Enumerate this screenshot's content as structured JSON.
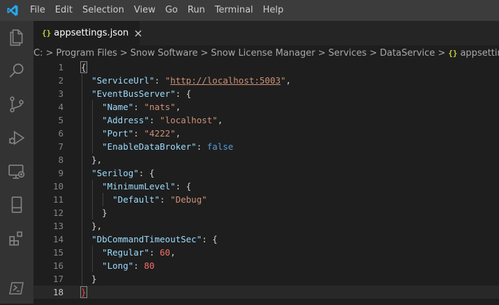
{
  "menu": [
    "File",
    "Edit",
    "Selection",
    "View",
    "Go",
    "Run",
    "Terminal",
    "Help"
  ],
  "tab": {
    "icon": "{}",
    "label": "appsettings.json"
  },
  "breadcrumb": {
    "parts": [
      "C:",
      "Program Files",
      "Snow Software",
      "Snow License Manager",
      "Services",
      "DataService"
    ],
    "file_icon": "{}",
    "file": "appsettings.json",
    "trailing": ">"
  },
  "lines": [
    {
      "n": "1",
      "tokens": [
        {
          "t": "{",
          "c": "brace-hl"
        }
      ]
    },
    {
      "n": "2",
      "tokens": [
        {
          "t": "  "
        },
        {
          "t": "\"ServiceUrl\"",
          "c": "k"
        },
        {
          "t": ": "
        },
        {
          "t": "\"",
          "c": "s"
        },
        {
          "t": "http://localhost:5003",
          "c": "s url"
        },
        {
          "t": "\"",
          "c": "s"
        },
        {
          "t": ","
        }
      ]
    },
    {
      "n": "3",
      "tokens": [
        {
          "t": "  "
        },
        {
          "t": "\"EventBusServer\"",
          "c": "k"
        },
        {
          "t": ": {"
        }
      ]
    },
    {
      "n": "4",
      "tokens": [
        {
          "t": "    "
        },
        {
          "t": "\"Name\"",
          "c": "k"
        },
        {
          "t": ": "
        },
        {
          "t": "\"nats\"",
          "c": "s"
        },
        {
          "t": ","
        }
      ]
    },
    {
      "n": "5",
      "tokens": [
        {
          "t": "    "
        },
        {
          "t": "\"Address\"",
          "c": "k"
        },
        {
          "t": ": "
        },
        {
          "t": "\"localhost\"",
          "c": "s"
        },
        {
          "t": ","
        }
      ]
    },
    {
      "n": "6",
      "tokens": [
        {
          "t": "    "
        },
        {
          "t": "\"Port\"",
          "c": "k"
        },
        {
          "t": ": "
        },
        {
          "t": "\"4222\"",
          "c": "s"
        },
        {
          "t": ","
        }
      ]
    },
    {
      "n": "7",
      "tokens": [
        {
          "t": "    "
        },
        {
          "t": "\"EnableDataBroker\"",
          "c": "k"
        },
        {
          "t": ": "
        },
        {
          "t": "false",
          "c": "kw"
        }
      ]
    },
    {
      "n": "8",
      "tokens": [
        {
          "t": "  },"
        }
      ]
    },
    {
      "n": "9",
      "tokens": [
        {
          "t": "  "
        },
        {
          "t": "\"Serilog\"",
          "c": "k"
        },
        {
          "t": ": {"
        }
      ]
    },
    {
      "n": "10",
      "tokens": [
        {
          "t": "    "
        },
        {
          "t": "\"MinimumLevel\"",
          "c": "k"
        },
        {
          "t": ": {"
        }
      ]
    },
    {
      "n": "11",
      "tokens": [
        {
          "t": "      "
        },
        {
          "t": "\"Default\"",
          "c": "k"
        },
        {
          "t": ": "
        },
        {
          "t": "\"Debug\"",
          "c": "s"
        }
      ]
    },
    {
      "n": "12",
      "tokens": [
        {
          "t": "    }"
        }
      ]
    },
    {
      "n": "13",
      "tokens": [
        {
          "t": "  },"
        }
      ]
    },
    {
      "n": "14",
      "tokens": [
        {
          "t": "  "
        },
        {
          "t": "\"DbCommandTimeoutSec\"",
          "c": "k"
        },
        {
          "t": ": {"
        }
      ]
    },
    {
      "n": "15",
      "tokens": [
        {
          "t": "    "
        },
        {
          "t": "\"Regular\"",
          "c": "k"
        },
        {
          "t": ": "
        },
        {
          "t": "60",
          "c": "num"
        },
        {
          "t": ","
        }
      ]
    },
    {
      "n": "16",
      "tokens": [
        {
          "t": "    "
        },
        {
          "t": "\"Long\"",
          "c": "k"
        },
        {
          "t": ": "
        },
        {
          "t": "80",
          "c": "num"
        }
      ]
    },
    {
      "n": "17",
      "tokens": [
        {
          "t": "  }"
        }
      ]
    },
    {
      "n": "18",
      "tokens": [
        {
          "t": "}",
          "c": "brace-red"
        }
      ]
    }
  ],
  "active_line": "18",
  "colors": {
    "titlebar": "#3c3c3c",
    "activitybar": "#333333",
    "editor": "#1e1e1e",
    "json_icon": "#cbcb41"
  }
}
